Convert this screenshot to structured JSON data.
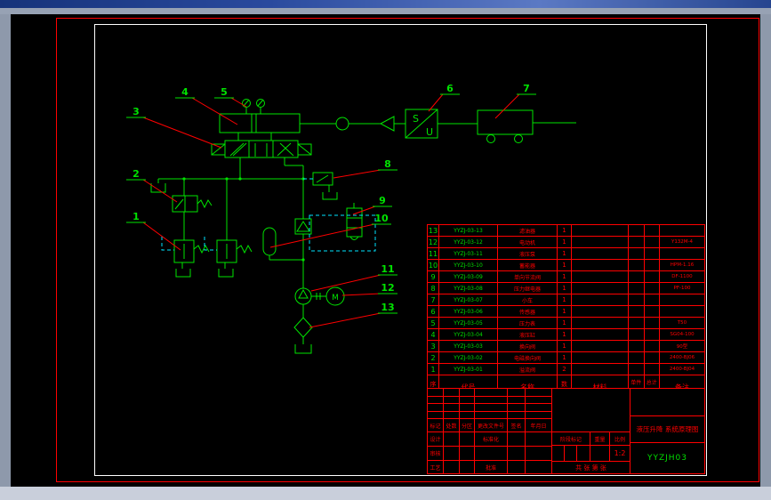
{
  "schematic": {
    "callouts": [
      "1",
      "2",
      "3",
      "4",
      "5",
      "6",
      "7",
      "8",
      "9",
      "10",
      "11",
      "12",
      "13"
    ],
    "sensor_box": {
      "top": "S",
      "bottom": "U"
    },
    "motor_label": "M",
    "line_color": "#00e400",
    "leader_color": "#ff0000",
    "pilot_color": "#00e5ff"
  },
  "bom": {
    "header": {
      "no": "序号",
      "code": "代号",
      "name": "名称",
      "qty": "数量",
      "material": "材料",
      "unit": "单件",
      "total": "总计",
      "weight": "重量",
      "remark": "备注"
    },
    "rows": [
      {
        "no": "13",
        "code": "YYZJ-03-13",
        "name": "滤油器",
        "qty": "1",
        "material": "",
        "remark": ""
      },
      {
        "no": "12",
        "code": "YYZJ-03-12",
        "name": "电动机",
        "qty": "1",
        "material": "",
        "remark": "Y132M-4"
      },
      {
        "no": "11",
        "code": "YYZJ-03-11",
        "name": "液压泵",
        "qty": "1",
        "material": "",
        "remark": ""
      },
      {
        "no": "10",
        "code": "YYZJ-03-10",
        "name": "蓄能器",
        "qty": "1",
        "material": "",
        "remark": "HPM-1.16"
      },
      {
        "no": "9",
        "code": "YYZJ-03-09",
        "name": "单向节流阀",
        "qty": "1",
        "material": "",
        "remark": "DF-1100"
      },
      {
        "no": "8",
        "code": "YYZJ-03-08",
        "name": "压力继电器",
        "qty": "1",
        "material": "",
        "remark": "PF-100"
      },
      {
        "no": "7",
        "code": "YYZJ-03-07",
        "name": "小车",
        "qty": "1",
        "material": "",
        "remark": ""
      },
      {
        "no": "6",
        "code": "YYZJ-03-06",
        "name": "传感器",
        "qty": "1",
        "material": "",
        "remark": ""
      },
      {
        "no": "5",
        "code": "YYZJ-03-05",
        "name": "压力表",
        "qty": "1",
        "material": "",
        "remark": "T50"
      },
      {
        "no": "4",
        "code": "YYZJ-03-04",
        "name": "液压缸",
        "qty": "1",
        "material": "",
        "remark": "SG04-100"
      },
      {
        "no": "3",
        "code": "YYZJ-03-03",
        "name": "换向阀",
        "qty": "1",
        "material": "",
        "remark": "90型"
      },
      {
        "no": "2",
        "code": "YYZJ-03-02",
        "name": "电磁换向阀",
        "qty": "1",
        "material": "",
        "remark": "2400-BJ06"
      },
      {
        "no": "1",
        "code": "YYZJ-03-01",
        "name": "溢流阀",
        "qty": "2",
        "material": "",
        "remark": "2400-BJ04"
      }
    ]
  },
  "titleblock": {
    "labels": {
      "mark": "标记",
      "count": "处数",
      "zone": "分区",
      "change_doc": "更改文件号",
      "sign": "签名",
      "date": "年月日",
      "design": "设计",
      "standardize": "标准化",
      "check": "审核",
      "process": "工艺",
      "approve": "批准",
      "stage_mark": "阶段标记",
      "weight": "重量",
      "scale_label": "比例"
    },
    "scale_value": "1:2",
    "sheet_info": "共  张 第  张",
    "title": "液压升降 系统原理图",
    "drawing_no": "YYZJH03"
  }
}
